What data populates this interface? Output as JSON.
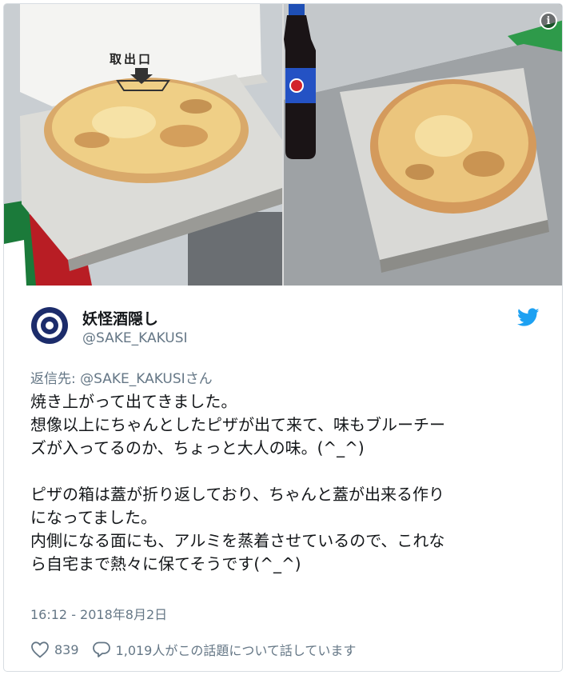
{
  "media": {
    "info_icon": "info-icon",
    "photos": [
      {
        "name": "pizza-box-in-vending-slot-photo",
        "stamp_text": "取出口"
      },
      {
        "name": "pizza-on-counter-with-cola-photo"
      }
    ]
  },
  "user": {
    "display_name": "妖怪酒隠し",
    "handle": "@SAKE_KAKUSI",
    "avatar_icon": "target-avatar-icon"
  },
  "reply_to": {
    "prefix": "返信先: ",
    "handle": "@SAKE_KAKUSI",
    "suffix": "さん"
  },
  "tweet": {
    "lines": [
      "焼き上がって出てきました。",
      "想像以上にちゃんとしたピザが出て来て、味もブルーチー",
      "ズが入ってるのか、ちょっと大人の味。(^_^)",
      "",
      "ピザの箱は蓋が折り返しており、ちゃんと蓋が出来る作り",
      "になってました。",
      "内側になる面にも、アルミを蒸着させているので、これな",
      "ら自宅まで熱々に保てそうです(^_^)"
    ]
  },
  "timestamp": "16:12 - 2018年8月2日",
  "actions": {
    "like_count": "839",
    "reply_text": "1,019人がこの話題について話しています"
  },
  "colors": {
    "brand_blue": "#1da1f2",
    "avatar_navy": "#1c2c6b",
    "muted_text": "#657786"
  }
}
